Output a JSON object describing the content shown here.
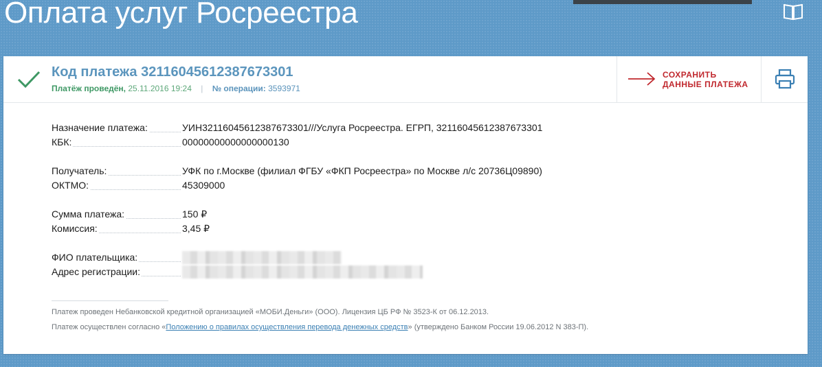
{
  "page": {
    "title": "Оплата услуг Росреестра"
  },
  "payment": {
    "code": "Код платежа 32116045612387673301",
    "status": "Платёж проведён,",
    "date": "25.11.2016 19:24",
    "separator": "|",
    "operation_label": "№ операции:",
    "operation_value": "3593971"
  },
  "actions": {
    "save_line1": "СОХРАНИТЬ",
    "save_line2": "ДАННЫЕ ПЛАТЕЖА"
  },
  "details": {
    "purpose_label": "Назначение платежа:",
    "purpose_value": "УИН32116045612387673301///Услуга Росреестра. ЕГРП, 32116045612387673301",
    "kbk_label": "КБК:",
    "kbk_value": "00000000000000000130",
    "recipient_label": "Получатель:",
    "recipient_value": "УФК по г.Москве (филиал ФГБУ «ФКП Росреестра» по Москве л/с 20736Ц09890)",
    "oktmo_label": "ОКТМО:",
    "oktmo_value": "45309000",
    "amount_label": "Сумма платежа:",
    "amount_value": "150 ₽",
    "fee_label": "Комиссия:",
    "fee_value": "3,45 ₽",
    "payer_label": "ФИО плательщика:",
    "address_label": "Адрес регистрации:"
  },
  "footer": {
    "note1": "Платеж проведен Небанковской кредитной организацией «МОБИ.Деньги» (ООО). Лицензия ЦБ РФ № 3523-К от 06.12.2013.",
    "note2_prefix": "Платеж осуществлен согласно «",
    "note2_link": "Положению о правилах осуществления перевода денежных средств",
    "note2_suffix": "» (утверждено Банком России 19.06.2012 N 383-П)."
  },
  "colors": {
    "background": "#5e9ac8",
    "accent_red": "#c0272d",
    "status_green": "#3e9864",
    "code_blue": "#5b95bd"
  },
  "icons": {
    "book": "book-icon",
    "check": "check-icon",
    "arrow": "arrow-right-icon",
    "printer": "printer-icon"
  }
}
